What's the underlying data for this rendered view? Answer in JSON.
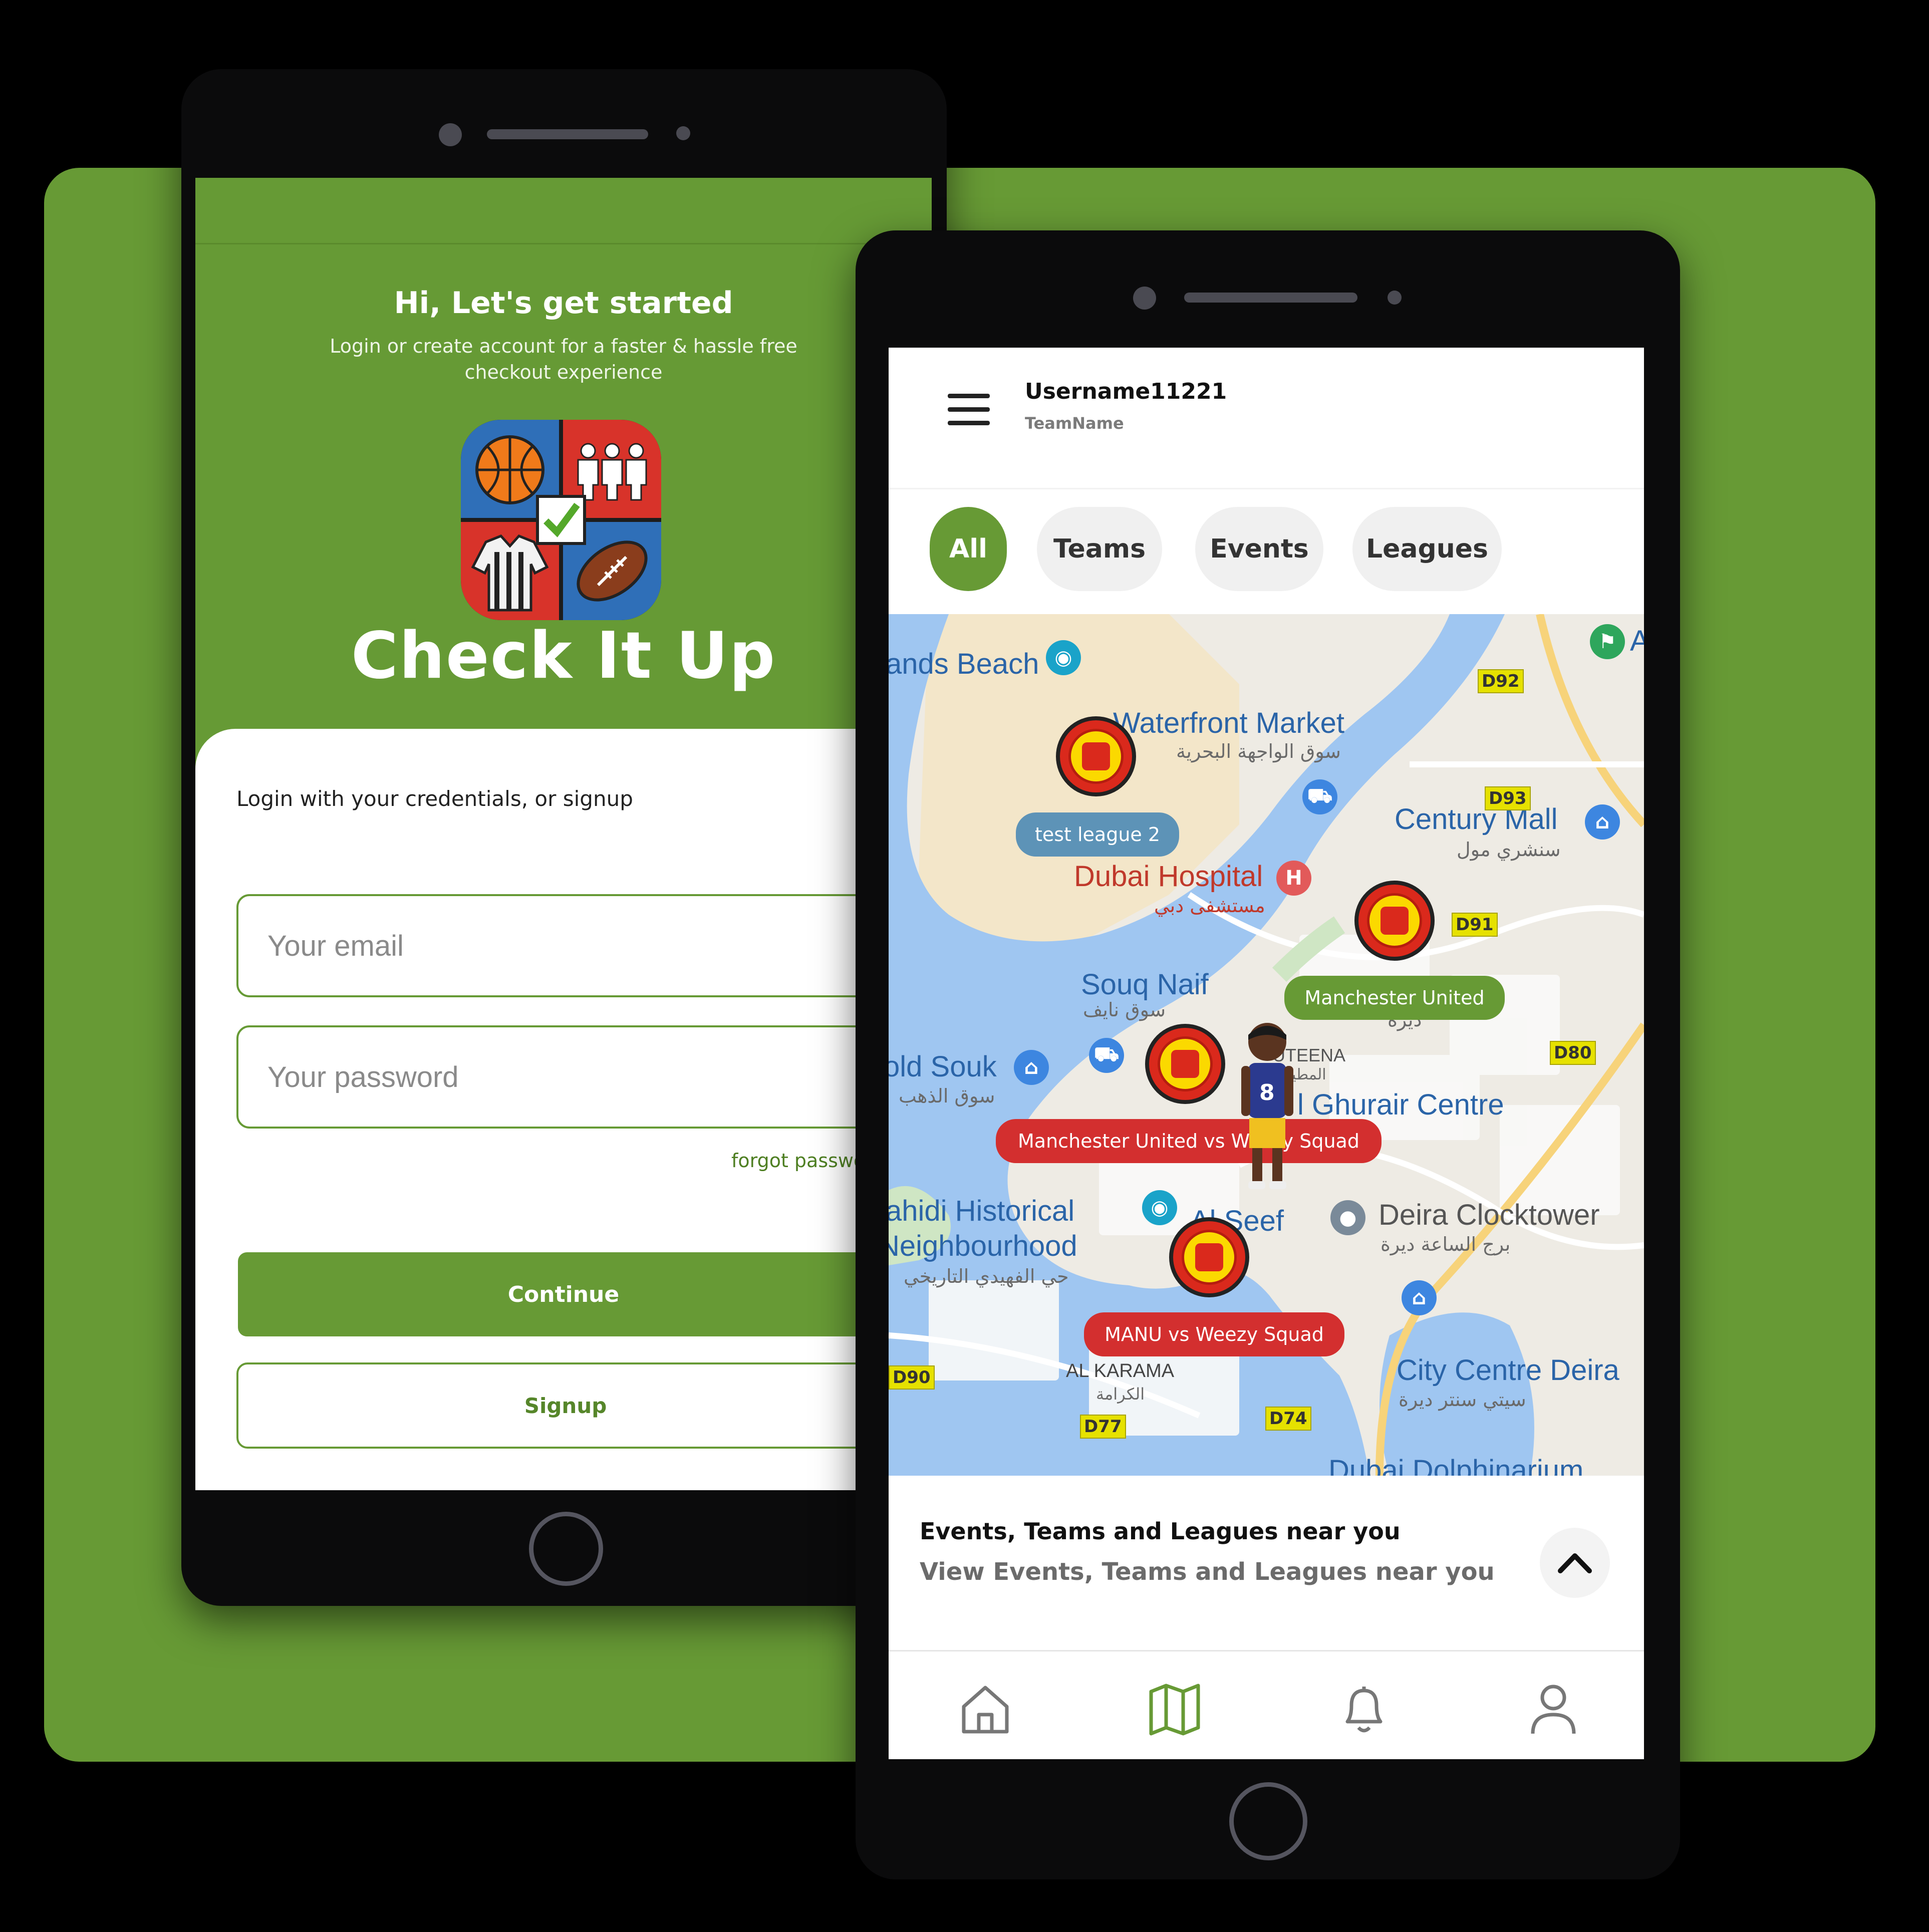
{
  "login": {
    "greeting": "Hi, Let's get started",
    "subtitle": "Login or create account for a faster & hassle free checkout experience",
    "logo_text": "Check It Up",
    "card_title": "Login with your credentials, or signup",
    "email_placeholder": "Your email",
    "password_placeholder": "Your password",
    "forgot": "forgot password?",
    "continue_label": "Continue",
    "signup_label": "Signup"
  },
  "map_screen": {
    "username": "Username11221",
    "team_name": "TeamName",
    "chips": [
      "All",
      "Teams",
      "Events",
      "Leagues"
    ],
    "active_chip": "All",
    "map": {
      "places": {
        "beach": "ands Beach",
        "waterfront": "Waterfront Market",
        "waterfront_ar": "سوق الواجهة البحرية",
        "century": "Century Mall",
        "century_ar": "سنشري مول",
        "hospital": "Dubai Hospital",
        "hospital_ar": "مستشفى دبي",
        "souq": "Souq Naif",
        "souq_ar": "سوق نايف",
        "gold": "old Souk",
        "gold_ar": "سوق الذهب",
        "muteena": "UTEENA",
        "muteena_ar": "المطينة",
        "ghurair": "l Ghurair Centre",
        "shindagha": "ahidi Historical",
        "shindagha2": "Neighbourhood",
        "shindagha_ar": "حي الفهيدي التاريخي",
        "seef": "Al Seef",
        "clocktower": "Deira Clocktower",
        "clocktower_ar": "برج الساعة ديرة",
        "citycentre": "City Centre Deira",
        "citycentre_ar": "سيتي سنتر ديرة",
        "karama": "AL KARAMA",
        "karama_ar": "الكرامة",
        "dolphin": "Dubai Dolphinarium",
        "deira_ar": "ديرة",
        "corner": "A"
      },
      "roads": [
        "D92",
        "D93",
        "D91",
        "D80",
        "D90",
        "D77",
        "D74"
      ],
      "pins": [
        {
          "label": "test league 2",
          "kind": "league"
        },
        {
          "label": "Manchester United",
          "kind": "team"
        },
        {
          "label": "Manchester United vs Weezy Squad",
          "kind": "event"
        },
        {
          "label": "MANU vs Weezy Squad",
          "kind": "event"
        }
      ],
      "avatar_number": "8"
    },
    "sheet": {
      "title": "Events, Teams and Leagues near you",
      "subtitle": "View Events, Teams and Leagues near you"
    },
    "nav": [
      {
        "icon": "home-icon"
      },
      {
        "icon": "map-icon",
        "active": true
      },
      {
        "icon": "bell-icon"
      },
      {
        "icon": "user-icon"
      }
    ]
  },
  "colors": {
    "brand_green": "#679a35",
    "event_red": "#d32f2f",
    "league_blue": "#5d93b7"
  }
}
